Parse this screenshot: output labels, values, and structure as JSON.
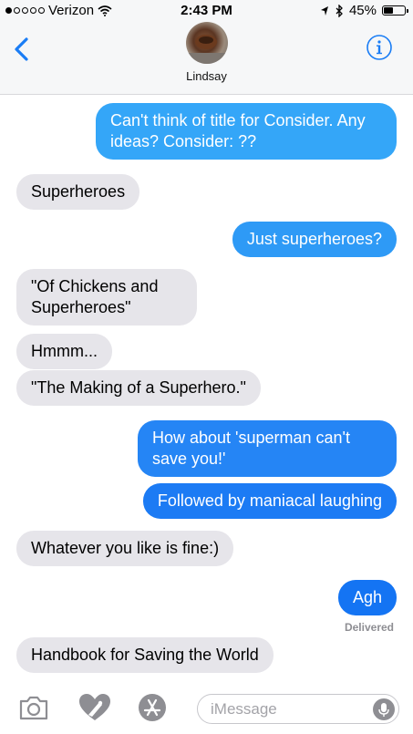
{
  "status_bar": {
    "carrier": "Verizon",
    "time": "2:43 PM",
    "battery": "45%",
    "battery_level": 0.45
  },
  "header": {
    "contact_name": "Lindsay",
    "icons": {
      "back": "chevron-left-icon",
      "info": "info-icon"
    }
  },
  "messages": [
    {
      "dir": "out",
      "color": "#34a6f8",
      "text": "Can't think of title for Consider. Any ideas?  Consider: ??"
    },
    {
      "dir": "in",
      "text": "Superheroes"
    },
    {
      "dir": "out",
      "color": "#2e9af6",
      "text": "Just superheroes?"
    },
    {
      "dir": "in",
      "text": "\"Of Chickens and Superheroes\""
    },
    {
      "dir": "in",
      "text": "Hmmm..."
    },
    {
      "dir": "in",
      "text": "\"The Making of a Superhero.\""
    },
    {
      "dir": "out",
      "color": "#2585f5",
      "text": "How about 'superman can't save you!'"
    },
    {
      "dir": "out",
      "color": "#1c7bf4",
      "text": "Followed by maniacal laughing"
    },
    {
      "dir": "in",
      "text": "Whatever you like is fine:)"
    },
    {
      "dir": "out",
      "color": "#1474f3",
      "text": "Agh"
    },
    {
      "dir": "in",
      "text": "Handbook for Saving the World"
    }
  ],
  "delivered_label": "Delivered",
  "input_bar": {
    "placeholder": "iMessage",
    "icons": [
      "camera-icon",
      "digital-touch-icon",
      "app-store-icon",
      "microphone-icon"
    ]
  },
  "colors": {
    "accent": "#1a7df5",
    "incoming_bubble": "#e6e5ea",
    "icon_gray": "#8e8e93"
  }
}
